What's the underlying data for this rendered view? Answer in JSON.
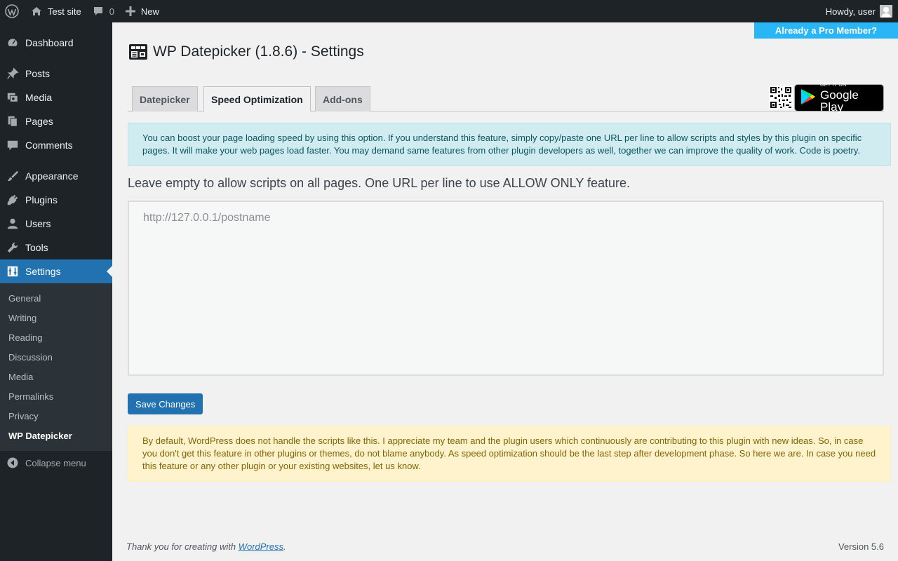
{
  "adminbar": {
    "wp_logo_icon": "wordpress-logo-icon",
    "site_name": "Test site",
    "comments_count": "0",
    "new_label": "New",
    "howdy": "Howdy, user"
  },
  "sidebar": {
    "items": [
      {
        "label": "Dashboard",
        "icon": "dashboard-icon"
      },
      {
        "label": "Posts",
        "icon": "pin-icon"
      },
      {
        "label": "Media",
        "icon": "media-icon"
      },
      {
        "label": "Pages",
        "icon": "pages-icon"
      },
      {
        "label": "Comments",
        "icon": "comment-icon"
      },
      {
        "label": "Appearance",
        "icon": "brush-icon"
      },
      {
        "label": "Plugins",
        "icon": "plug-icon"
      },
      {
        "label": "Users",
        "icon": "user-icon"
      },
      {
        "label": "Tools",
        "icon": "wrench-icon"
      },
      {
        "label": "Settings",
        "icon": "settings-icon"
      }
    ],
    "submenu": [
      "General",
      "Writing",
      "Reading",
      "Discussion",
      "Media",
      "Permalinks",
      "Privacy",
      "WP Datepicker"
    ],
    "collapse_label": "Collapse menu"
  },
  "main": {
    "pro_banner": "Already a Pro Member?",
    "title": "WP Datepicker (1.8.6) - Settings",
    "tabs": [
      {
        "label": "Datepicker",
        "active": false
      },
      {
        "label": "Speed Optimization",
        "active": true
      },
      {
        "label": "Add-ons",
        "active": false
      }
    ],
    "gplay": {
      "small": "GET IT ON",
      "big": "Google Play"
    },
    "info_notice": "You can boost your page loading speed by using this option. If you understand this feature, simply copy/paste one URL per line to allow scripts and styles by this plugin on specific pages. It will make your web pages load faster. You may demand same features from other plugin developers as well, together we can improve the quality of work. Code is poetry.",
    "lead": "Leave empty to allow scripts on all pages. One URL per line to use ALLOW ONLY feature.",
    "textarea_placeholder": "http://127.0.0.1/postname",
    "save_label": "Save Changes",
    "warn_notice": "By default, WordPress does not handle the scripts like this. I appreciate my team and the plugin users which continuously are contributing to this plugin with new ideas. So, in case you don't get this feature in other plugins or themes, do not blame anybody. As speed optimization should be the last step after development phase. So here we are. In case you need this feature or any other plugin or your existing websites, let us know."
  },
  "footer": {
    "thanks_prefix": "Thank you for creating with ",
    "wp_link": "WordPress",
    "thanks_suffix": ".",
    "version": "Version 5.6"
  },
  "colors": {
    "adminbar_bg": "#1d2327",
    "accent": "#2271b1",
    "pro_banner": "#29b6f6",
    "info_bg": "#d1ecf1",
    "warn_bg": "#fff3cd"
  }
}
